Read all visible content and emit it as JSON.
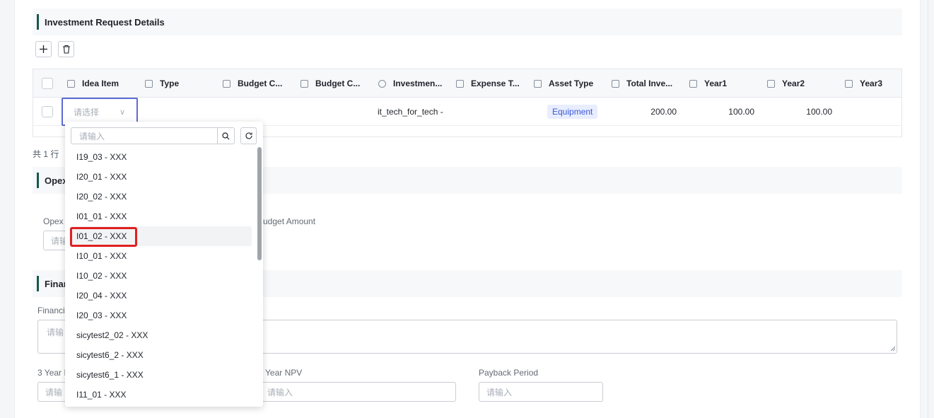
{
  "investment_section": {
    "title": "Investment Request Details"
  },
  "toolbar": {
    "add_icon": "plus-icon",
    "delete_icon": "trash-icon"
  },
  "grid": {
    "columns": [
      {
        "label": "Idea Item",
        "icon": "select-field-icon"
      },
      {
        "label": "Type",
        "icon": "select-field-icon"
      },
      {
        "label": "Budget C...",
        "icon": "select-field-icon"
      },
      {
        "label": "Budget C...",
        "icon": "text-field-icon"
      },
      {
        "label": "Investmen...",
        "icon": "radio-field-icon"
      },
      {
        "label": "Expense T...",
        "icon": "select-field-icon"
      },
      {
        "label": "Asset Type",
        "icon": "select-field-icon"
      },
      {
        "label": "Total Inve...",
        "icon": "number-field-icon"
      },
      {
        "label": "Year1",
        "icon": "number-field-icon"
      },
      {
        "label": "Year2",
        "icon": "number-field-icon"
      },
      {
        "label": "Year3",
        "icon": "number-field-icon"
      }
    ],
    "row": {
      "idea_item_placeholder": "请选择",
      "investment": "it_tech_for_tech -",
      "asset_type": "Equipment",
      "total_investment": "200.00",
      "year1": "100.00",
      "year2": "100.00"
    },
    "total_rows": "共 1 行"
  },
  "opex_section": {
    "title_visible": "Opex",
    "field1_label_visible": "Opex",
    "field1_placeholder_visible": "请输",
    "field2_label_visible": "udget Amount"
  },
  "financial_section": {
    "title_visible": "Finan",
    "field_label_visible": "Financi",
    "textarea_placeholder_visible": "请输",
    "year_label_visible": "3 Year I",
    "year_placeholder_visible": "请输",
    "npv_label_visible": "Year NPV",
    "npv_placeholder": "请输入",
    "payback_label": "Payback Period",
    "payback_placeholder": "请输入"
  },
  "dropdown": {
    "search_placeholder": "请输入",
    "items": [
      "I19_03 - XXX",
      "I20_01 - XXX",
      "I20_02 - XXX",
      "I01_01 - XXX",
      "I01_02 - XXX",
      "I10_01 - XXX",
      "I10_02 - XXX",
      "I20_04 - XXX",
      "I20_03 - XXX",
      "sicytest2_02 - XXX",
      "sicytest6_2 - XXX",
      "sicytest6_1 - XXX",
      "I11_01 - XXX"
    ],
    "hovered_index": 4,
    "highlight_color": "#e02020"
  },
  "colors": {
    "accent_bar": "#17584a",
    "focus_border": "#5b6bd5",
    "tag_bg": "#e8edff",
    "tag_text": "#3b59d6"
  }
}
